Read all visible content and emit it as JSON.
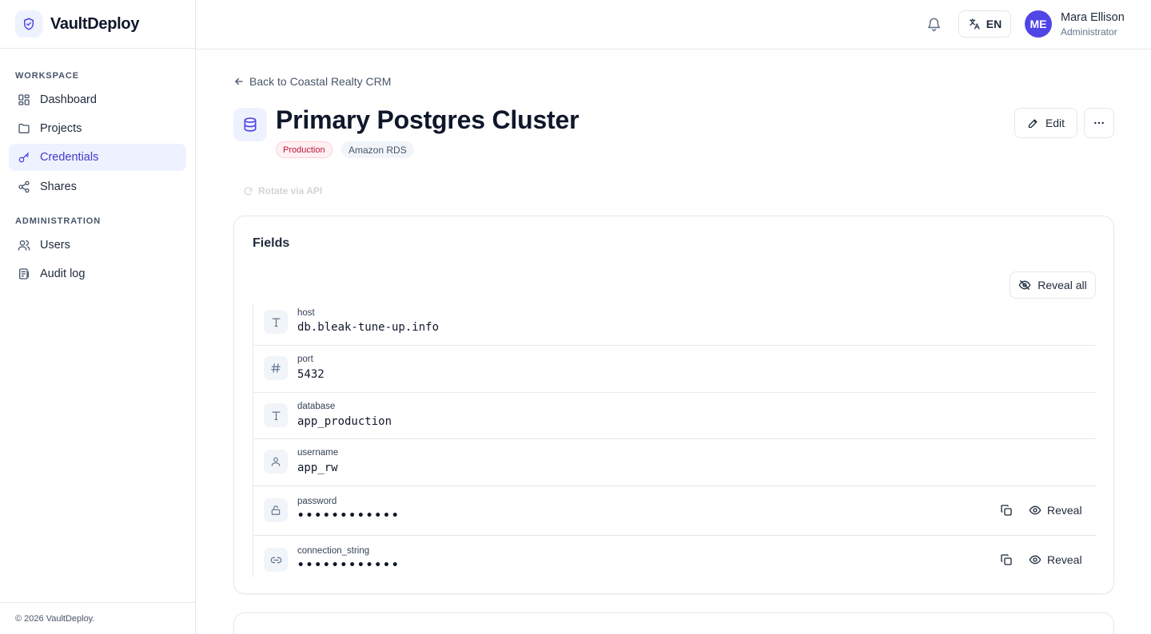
{
  "app": {
    "name": "VaultDeploy"
  },
  "sidebar": {
    "sections": [
      {
        "label": "Workspace",
        "items": [
          {
            "label": "Dashboard",
            "icon": "dashboard-icon"
          },
          {
            "label": "Projects",
            "icon": "folder-icon"
          },
          {
            "label": "Credentials",
            "icon": "key-icon",
            "active": true
          },
          {
            "label": "Shares",
            "icon": "share-icon"
          }
        ]
      },
      {
        "label": "Administration",
        "items": [
          {
            "label": "Users",
            "icon": "users-icon"
          },
          {
            "label": "Audit log",
            "icon": "audit-log-icon"
          }
        ]
      }
    ],
    "footer": "© 2026 VaultDeploy."
  },
  "header": {
    "language": "EN",
    "user": {
      "initials": "ME",
      "name": "Mara Ellison",
      "role": "Administrator"
    }
  },
  "page": {
    "back_link": "Back to Coastal Realty CRM",
    "title": "Primary Postgres Cluster",
    "environment": "Production",
    "provider": "Amazon RDS",
    "edit_label": "Edit",
    "disabled_action": "Rotate via API"
  },
  "fields_card": {
    "title": "Fields",
    "reveal_all_label": "Reveal all",
    "fields": [
      {
        "label": "host",
        "value": "db.bleak-tune-up.info",
        "icon": "text-icon"
      },
      {
        "label": "port",
        "value": "5432",
        "icon": "hash-icon"
      },
      {
        "label": "database",
        "value": "app_production",
        "icon": "text-icon"
      },
      {
        "label": "username",
        "value": "app_rw",
        "icon": "user-icon"
      },
      {
        "label": "password",
        "value": "••••••••••••",
        "icon": "lock-icon",
        "secret": true,
        "reveal_label": "Reveal"
      },
      {
        "label": "connection_string",
        "value": "••••••••••••",
        "icon": "link-icon",
        "secret": true,
        "reveal_label": "Reveal"
      }
    ]
  },
  "colors": {
    "accent": "#4f46e5",
    "accent_bg": "#eef2ff",
    "production": "#be123c"
  }
}
